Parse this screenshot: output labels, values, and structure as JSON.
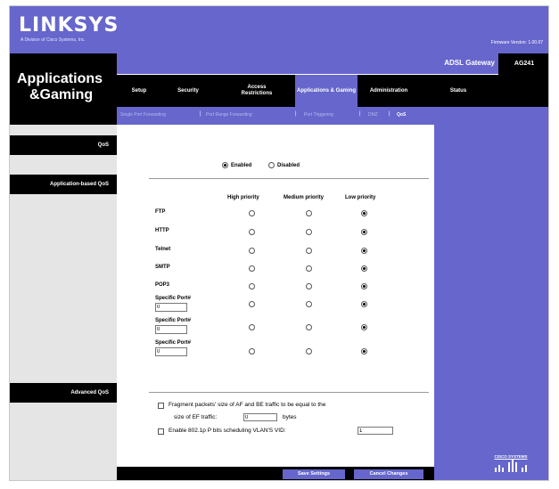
{
  "header": {
    "brand": "LINKSYS",
    "brand_sub": "A Division of Cisco Systems, Inc.",
    "firmware": "Firmware Version: 1.00.07",
    "product": "ADSL Gateway",
    "model": "AG241",
    "page_title_1": "Applications",
    "page_title_2": "&Gaming"
  },
  "tabs": [
    {
      "label": "Setup"
    },
    {
      "label": "Security"
    },
    {
      "label": "Access Restrictions"
    },
    {
      "label": "Applications & Gaming",
      "active": true
    },
    {
      "label": "Administration"
    },
    {
      "label": "Status"
    }
  ],
  "subtabs": [
    {
      "label": "Single Port Forwarding"
    },
    {
      "label": "Port Range Forwarding"
    },
    {
      "label": "Port Triggering"
    },
    {
      "label": "DMZ"
    },
    {
      "label": "QoS",
      "active": true
    }
  ],
  "sections": {
    "qos": "QoS",
    "app_qos": "Application-based QoS",
    "adv_qos": "Advanced QoS"
  },
  "qos_mode": {
    "enabled_label": "Enabled",
    "disabled_label": "Disabled",
    "selected": "enabled"
  },
  "priority_columns": [
    "High priority",
    "Medium priority",
    "Low priority"
  ],
  "apps": [
    {
      "label": "FTP",
      "selected": "low"
    },
    {
      "label": "HTTP",
      "selected": "low"
    },
    {
      "label": "Telnet",
      "selected": "low"
    },
    {
      "label": "SMTP",
      "selected": "low"
    },
    {
      "label": "POP3",
      "selected": "low"
    },
    {
      "label": "Specific Port#",
      "port": "0",
      "selected": "low"
    },
    {
      "label": "Specific Port#",
      "port": "0",
      "selected": "low"
    },
    {
      "label": "Specific Port#",
      "port": "0",
      "selected": "low"
    }
  ],
  "advanced": {
    "fragment_text_1": "Fragment packets' size of AF and BE traffic to be equal to the",
    "fragment_text_2": "size of EF traffic:",
    "fragment_value": "0",
    "fragment_unit": "bytes",
    "vlan_text": "Enable 802.1p P bits scheduling VLAN'S VID:",
    "vlan_value": "1"
  },
  "buttons": {
    "save": "Save Settings",
    "cancel": "Cancel Changes"
  },
  "footer": {
    "cisco": "CISCO SYSTEMS"
  },
  "colors": {
    "brand_purple": "#6666cc",
    "black": "#000000",
    "gray": "#e5e5e5"
  }
}
